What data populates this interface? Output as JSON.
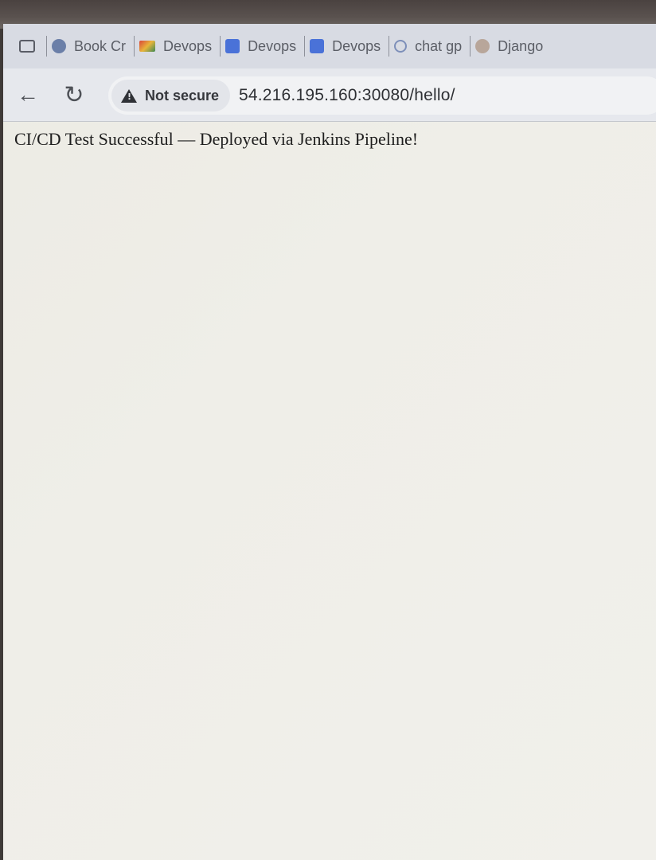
{
  "browser": {
    "bookmarks": [
      {
        "label": "Book Cr",
        "icon": "globe-icon"
      },
      {
        "label": "Devops",
        "icon": "gmail-icon"
      },
      {
        "label": "Devops",
        "icon": "docs-icon"
      },
      {
        "label": "Devops",
        "icon": "docs-icon"
      },
      {
        "label": "chat gp",
        "icon": "search-icon"
      },
      {
        "label": "Django",
        "icon": "person-icon"
      }
    ],
    "security_label": "Not secure",
    "url": "54.216.195.160:30080/hello/"
  },
  "page": {
    "message": "CI/CD Test Successful — Deployed via Jenkins Pipeline!"
  }
}
